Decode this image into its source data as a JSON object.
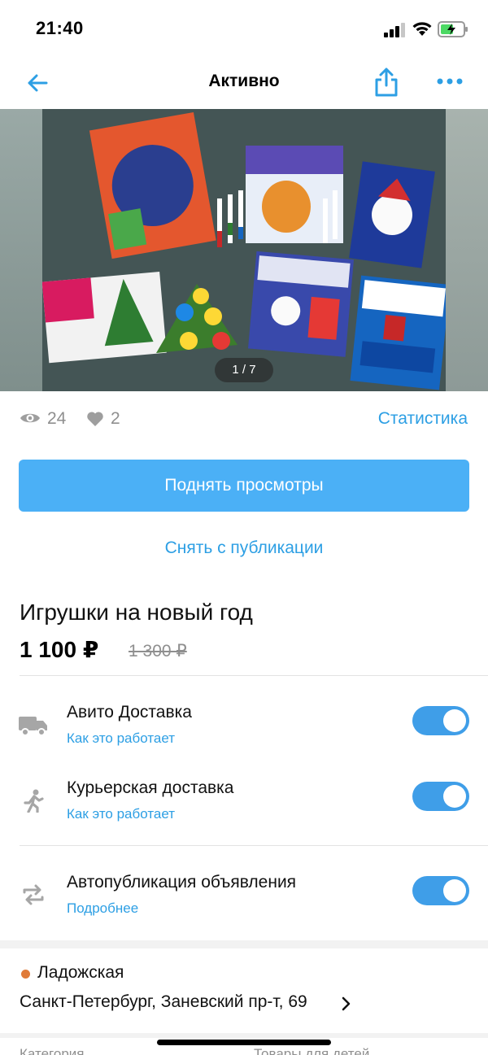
{
  "status_bar": {
    "time": "21:40"
  },
  "nav": {
    "title": "Активно"
  },
  "gallery": {
    "counter": "1 / 7"
  },
  "stats": {
    "views": "24",
    "likes": "2",
    "statistics_label": "Статистика"
  },
  "actions": {
    "promote_label": "Поднять просмотры",
    "unpublish_label": "Снять с публикации"
  },
  "item": {
    "title": "Игрушки на новый год",
    "price": "1 100 ₽",
    "old_price": "1 300 ₽"
  },
  "options": [
    {
      "label": "Авито Доставка",
      "link": "Как это работает",
      "enabled": true,
      "icon": "truck-icon"
    },
    {
      "label": "Курьерская доставка",
      "link": "Как это работает",
      "enabled": true,
      "icon": "courier-icon"
    },
    {
      "label": "Автопубликация объявления",
      "link": "Подробнее",
      "enabled": true,
      "icon": "autopublish-icon"
    }
  ],
  "location": {
    "metro": "Ладожская",
    "address": "Санкт-Петербург, Заневский пр-т, 69",
    "metro_color": "#e07b39"
  },
  "bottom_peek": {
    "left": "Категория",
    "right": "Товары для детей"
  },
  "colors": {
    "accent": "#2d9fe4",
    "button": "#4bb0f6",
    "toggle": "#3f9ee8"
  }
}
